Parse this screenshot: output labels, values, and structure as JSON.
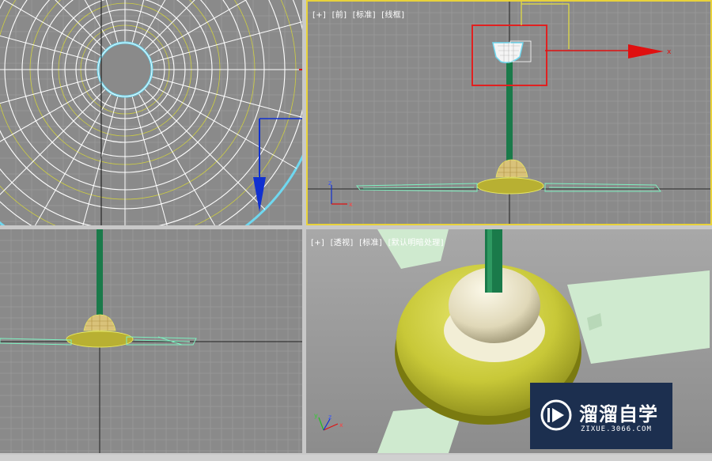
{
  "viewports": {
    "top_right": {
      "labels": [
        "[+]",
        "[前]",
        "[标准]",
        "[线框]"
      ]
    },
    "bottom_right": {
      "labels": [
        "[+]",
        "[透视]",
        "[标准]",
        "[默认明暗处理]"
      ]
    }
  },
  "axes": {
    "x": "x",
    "y": "y",
    "z": "z"
  },
  "watermark": {
    "brand": "溜溜自学",
    "url": "ZIXUE.3066.COM"
  },
  "colors": {
    "active_border": "#e8d23a",
    "viewport_bg": "#8a8a8a",
    "grid": "#a0a0a0",
    "selection_box": "#e02020",
    "gizmo_x": "#e01010",
    "gizmo_y": "#20c020",
    "gizmo_z": "#1030d0",
    "pole": "#1a7a4a",
    "base": "#c8c040",
    "wire": "#e8e860"
  }
}
